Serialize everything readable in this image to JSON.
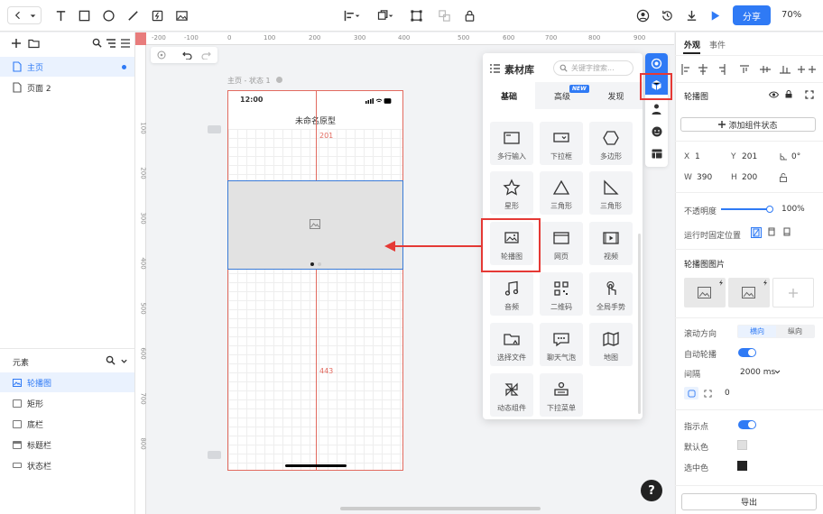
{
  "toolbar": {
    "share_label": "分享",
    "zoom": "70%"
  },
  "left_panel": {
    "pages": [
      {
        "label": "主页"
      },
      {
        "label": "页面 2"
      }
    ],
    "elements_title": "元素",
    "layers": [
      {
        "label": "轮播图"
      },
      {
        "label": "矩形"
      },
      {
        "label": "底栏"
      },
      {
        "label": "标题栏"
      },
      {
        "label": "状态栏"
      }
    ]
  },
  "canvas": {
    "ruler_h": [
      "-200",
      "-100",
      "0",
      "100",
      "200",
      "300",
      "400",
      "500",
      "600",
      "700",
      "800",
      "900"
    ],
    "ruler_v": [
      "100",
      "200",
      "300",
      "400",
      "500",
      "600",
      "700",
      "800"
    ],
    "state_label": "主页 - 状态 1",
    "phone_time": "12:00",
    "phone_title": "未命名原型",
    "dim_top": "201",
    "dim_bottom": "443"
  },
  "material": {
    "title": "素材库",
    "search_placeholder": "关键字搜索...",
    "tabs": [
      {
        "label": "基础"
      },
      {
        "label": "高级"
      },
      {
        "label": "发现"
      }
    ],
    "new_badge": "NEW",
    "items": [
      {
        "label": "多行输入"
      },
      {
        "label": "下拉框"
      },
      {
        "label": "多边形"
      },
      {
        "label": "星形"
      },
      {
        "label": "三角形"
      },
      {
        "label": "三角形"
      },
      {
        "label": "轮播图"
      },
      {
        "label": "网页"
      },
      {
        "label": "视频"
      },
      {
        "label": "音频"
      },
      {
        "label": "二维码"
      },
      {
        "label": "全局手势"
      },
      {
        "label": "选择文件"
      },
      {
        "label": "聊天气泡"
      },
      {
        "label": "地图"
      },
      {
        "label": "动态组件"
      },
      {
        "label": "下拉菜单"
      }
    ]
  },
  "right_panel": {
    "tabs": [
      {
        "label": "外观"
      },
      {
        "label": "事件"
      }
    ],
    "component_name": "轮播图",
    "add_state_label": "添加组件状态",
    "x_label": "X",
    "x_value": "1",
    "y_label": "Y",
    "y_value": "201",
    "rotation": "0°",
    "w_label": "W",
    "w_value": "390",
    "h_label": "H",
    "h_value": "200",
    "opacity_label": "不透明度",
    "opacity_value": "100%",
    "opacity_level": 1.0,
    "fixed_label": "运行时固定位置",
    "images_title": "轮播图图片",
    "scroll_label": "滚动方向",
    "scroll_h": "横向",
    "scroll_v": "纵向",
    "autoplay_label": "自动轮播",
    "interval_label": "间隔",
    "interval_value": "2000 ms",
    "corner_value": "0",
    "indicator_label": "指示点",
    "default_color_label": "默认色",
    "default_color": "#e0e0e0",
    "selected_color_label": "选中色",
    "selected_color": "#222222",
    "export_label": "导出"
  },
  "colors": {
    "accent": "#2f7af5",
    "highlight": "#e53935"
  }
}
